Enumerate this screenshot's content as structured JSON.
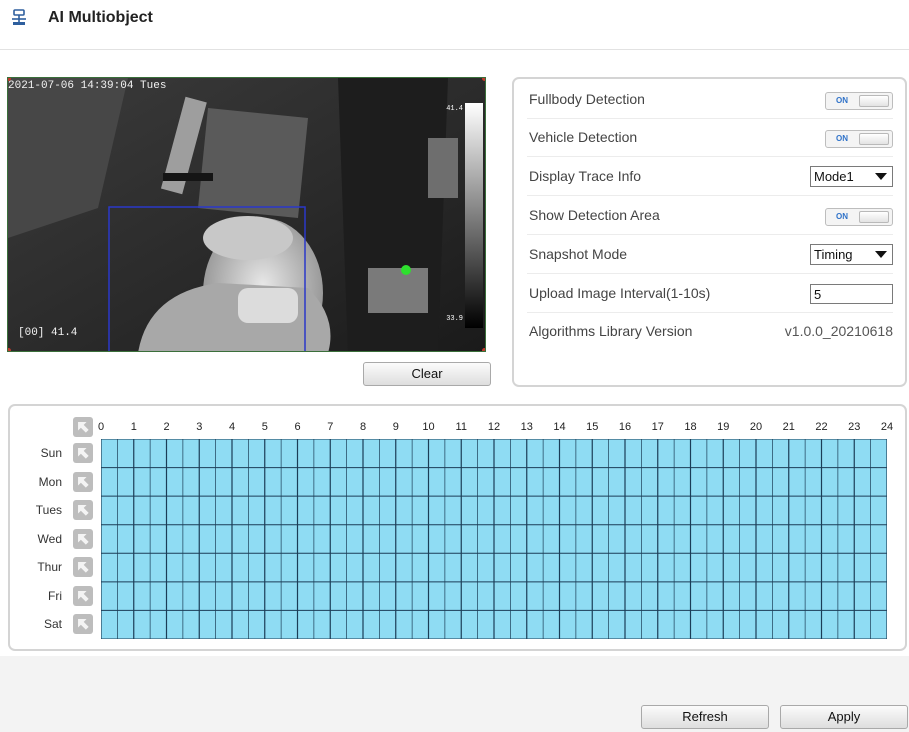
{
  "header": {
    "title": "AI Multiobject",
    "icon": "camera-mount-icon"
  },
  "video": {
    "timestamp": "2021-07-06 14:39:04 Tues",
    "corner_label": "[00] 41.4",
    "temp_max": "41.4",
    "temp_min": "33.9"
  },
  "buttons": {
    "clear": "Clear",
    "refresh": "Refresh",
    "apply": "Apply"
  },
  "settings": {
    "fullbody": {
      "label": "Fullbody Detection",
      "state": "ON"
    },
    "vehicle": {
      "label": "Vehicle Detection",
      "state": "ON"
    },
    "trace": {
      "label": "Display Trace Info",
      "value": "Mode1"
    },
    "area": {
      "label": "Show Detection Area",
      "state": "ON"
    },
    "snapshot": {
      "label": "Snapshot Mode",
      "value": "Timing"
    },
    "interval": {
      "label": "Upload Image Interval(1-10s)",
      "value": "5"
    },
    "library": {
      "label": "Algorithms Library Version",
      "value": "v1.0.0_20210618"
    }
  },
  "schedule": {
    "hours": [
      "0",
      "1",
      "2",
      "3",
      "4",
      "5",
      "6",
      "7",
      "8",
      "9",
      "10",
      "11",
      "12",
      "13",
      "14",
      "15",
      "16",
      "17",
      "18",
      "19",
      "20",
      "21",
      "22",
      "23",
      "24"
    ],
    "days": [
      "Sun",
      "Mon",
      "Tues",
      "Wed",
      "Thur",
      "Fri",
      "Sat"
    ],
    "cell_color": "#8fdcf3",
    "line_color": "#1b3d57"
  }
}
